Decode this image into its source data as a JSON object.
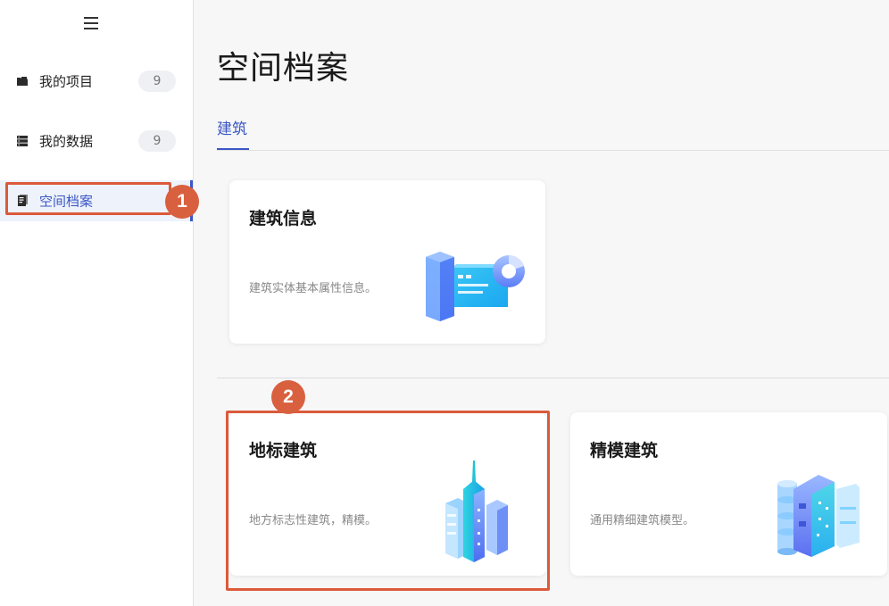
{
  "sidebar": {
    "items": [
      {
        "label": "我的项目",
        "badge": "9",
        "icon": "folder-icon"
      },
      {
        "label": "我的数据",
        "badge": "9",
        "icon": "database-icon"
      },
      {
        "label": "空间档案",
        "icon": "archive-icon",
        "active": true
      }
    ]
  },
  "main": {
    "title": "空间档案",
    "tabs": [
      {
        "label": "建筑",
        "active": true
      }
    ],
    "cards": [
      {
        "title": "建筑信息",
        "desc": "建筑实体基本属性信息。",
        "icon": "building-dashboard-illustration"
      },
      {
        "title": "地标建筑",
        "desc": "地方标志性建筑，精模。",
        "icon": "skyscraper-illustration"
      },
      {
        "title": "精模建筑",
        "desc": "通用精细建筑模型。",
        "icon": "detailed-building-illustration"
      }
    ]
  },
  "annotations": [
    "1",
    "2"
  ],
  "colors": {
    "accent": "#3a57c4",
    "annotation": "#dc5a3a"
  }
}
